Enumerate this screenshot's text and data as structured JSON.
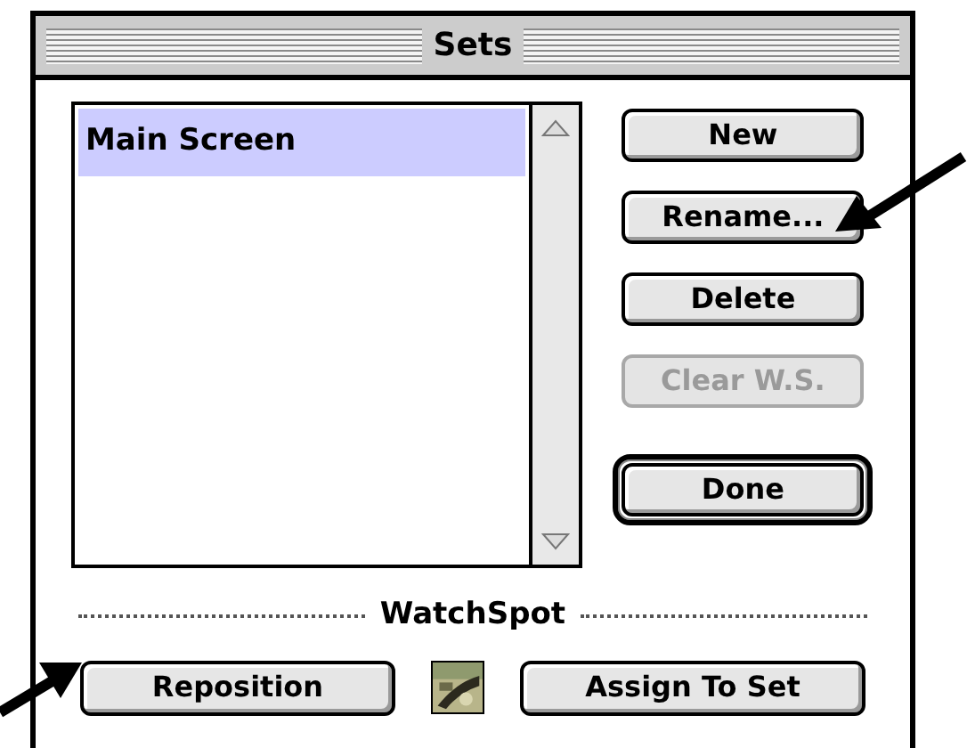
{
  "window": {
    "title": "Sets"
  },
  "list": {
    "items": [
      {
        "label": "Main Screen",
        "selected": true
      }
    ]
  },
  "buttons": [
    {
      "label": "New",
      "disabled": false,
      "default": false
    },
    {
      "label": "Rename...",
      "disabled": false,
      "default": false
    },
    {
      "label": "Delete",
      "disabled": false,
      "default": false
    },
    {
      "label": "Clear W.S.",
      "disabled": true,
      "default": false
    },
    {
      "label": "Done",
      "disabled": false,
      "default": true
    }
  ],
  "watchspot": {
    "heading": "WatchSpot",
    "buttons": [
      {
        "label": "Reposition",
        "disabled": false
      },
      {
        "label": "Assign To Set",
        "disabled": false
      }
    ]
  }
}
